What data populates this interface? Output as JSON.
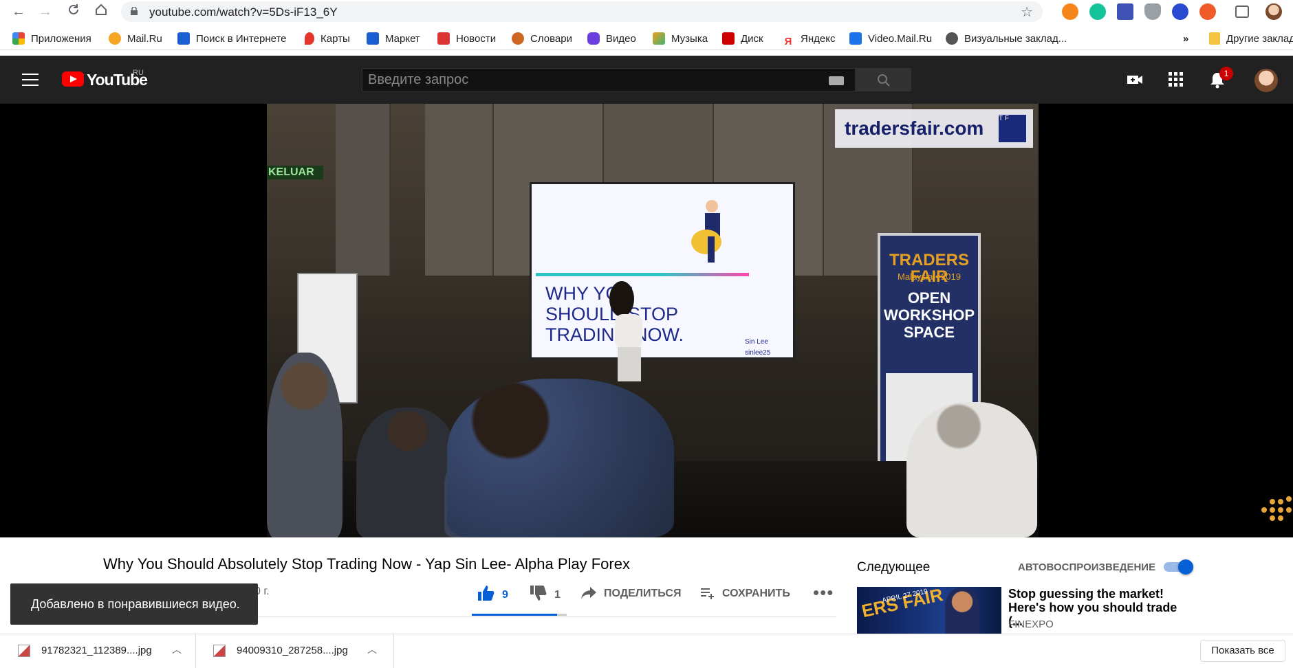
{
  "browser": {
    "url": "youtube.com/watch?v=5Ds-iF13_6Y",
    "bookmarks": [
      {
        "label": "Приложения",
        "icon": "apps-grid-icon",
        "color": "#e94235"
      },
      {
        "label": "Mail.Ru",
        "icon": "mailru-icon",
        "color": "#f5a623"
      },
      {
        "label": "Поиск в Интернете",
        "icon": "search-icon",
        "color": "#1a5fd1"
      },
      {
        "label": "Карты",
        "icon": "map-pin-icon",
        "color": "#e5342c"
      },
      {
        "label": "Маркет",
        "icon": "cart-icon",
        "color": "#1a5fd1"
      },
      {
        "label": "Новости",
        "icon": "news-icon",
        "color": "#d33"
      },
      {
        "label": "Словари",
        "icon": "dictionary-icon",
        "color": "#c62"
      },
      {
        "label": "Видео",
        "icon": "video-icon",
        "color": "#6a3fe0"
      },
      {
        "label": "Музыка",
        "icon": "music-icon",
        "color": "#f0a020"
      },
      {
        "label": "Диск",
        "icon": "disk-icon",
        "color": "#cc0000"
      },
      {
        "label": "Яндекс",
        "icon": "yandex-icon",
        "color": "#e33"
      },
      {
        "label": "Video.Mail.Ru",
        "icon": "videomail-icon",
        "color": "#1a73e8"
      },
      {
        "label": "Визуальные заклад...",
        "icon": "globe-icon",
        "color": "#555"
      }
    ],
    "bookmarks_overflow": "»",
    "other_bookmarks": "Другие закладки"
  },
  "header": {
    "logo_text": "YouTube",
    "logo_region": "RU",
    "search_placeholder": "Введите запрос",
    "notification_count": "1"
  },
  "video_frame": {
    "watermark": "tradersfair.com",
    "watermark_logo": "T F",
    "exit_sign": "KELUAR",
    "screen_text": "WHY YOU SHOULD STOP TRADING NOW.",
    "screen_handle_1": "Sin Lee",
    "screen_handle_2": "sinlee25",
    "banner_title": "TRADERS FAIR",
    "banner_sub": "Malaysia • 2019",
    "banner_main": "OPEN WORKSHOP SPACE"
  },
  "video": {
    "title": "Why You Should Absolutely Stop Trading Now - Yap Sin Lee- Alpha Play Forex",
    "views_fragment": "0 г.",
    "likes": "9",
    "dislikes": "1",
    "share_label": "ПОДЕЛИТЬСЯ",
    "save_label": "СОХРАНИТЬ",
    "like_ratio": 0.9
  },
  "toast": {
    "message": "Добавлено в понравившиеся видео."
  },
  "sidebar": {
    "next_label": "Следующее",
    "autoplay_label": "АВТОВОСПРОИЗВЕДЕНИЕ",
    "autoplay_on": true,
    "rec": {
      "title": "Stop guessing the market! Here's how you should trade (...",
      "channel": "FINEXPO",
      "thumb_text": "ERS FAIR",
      "thumb_date": "APRIL 27 2019"
    }
  },
  "downloads": {
    "items": [
      {
        "name": "91782321_112389....jpg"
      },
      {
        "name": "94009310_287258....jpg"
      }
    ],
    "show_all": "Показать все"
  },
  "colors": {
    "yt_red": "#ff0000",
    "yt_dark": "#212121",
    "accent_blue": "#065fd4"
  }
}
